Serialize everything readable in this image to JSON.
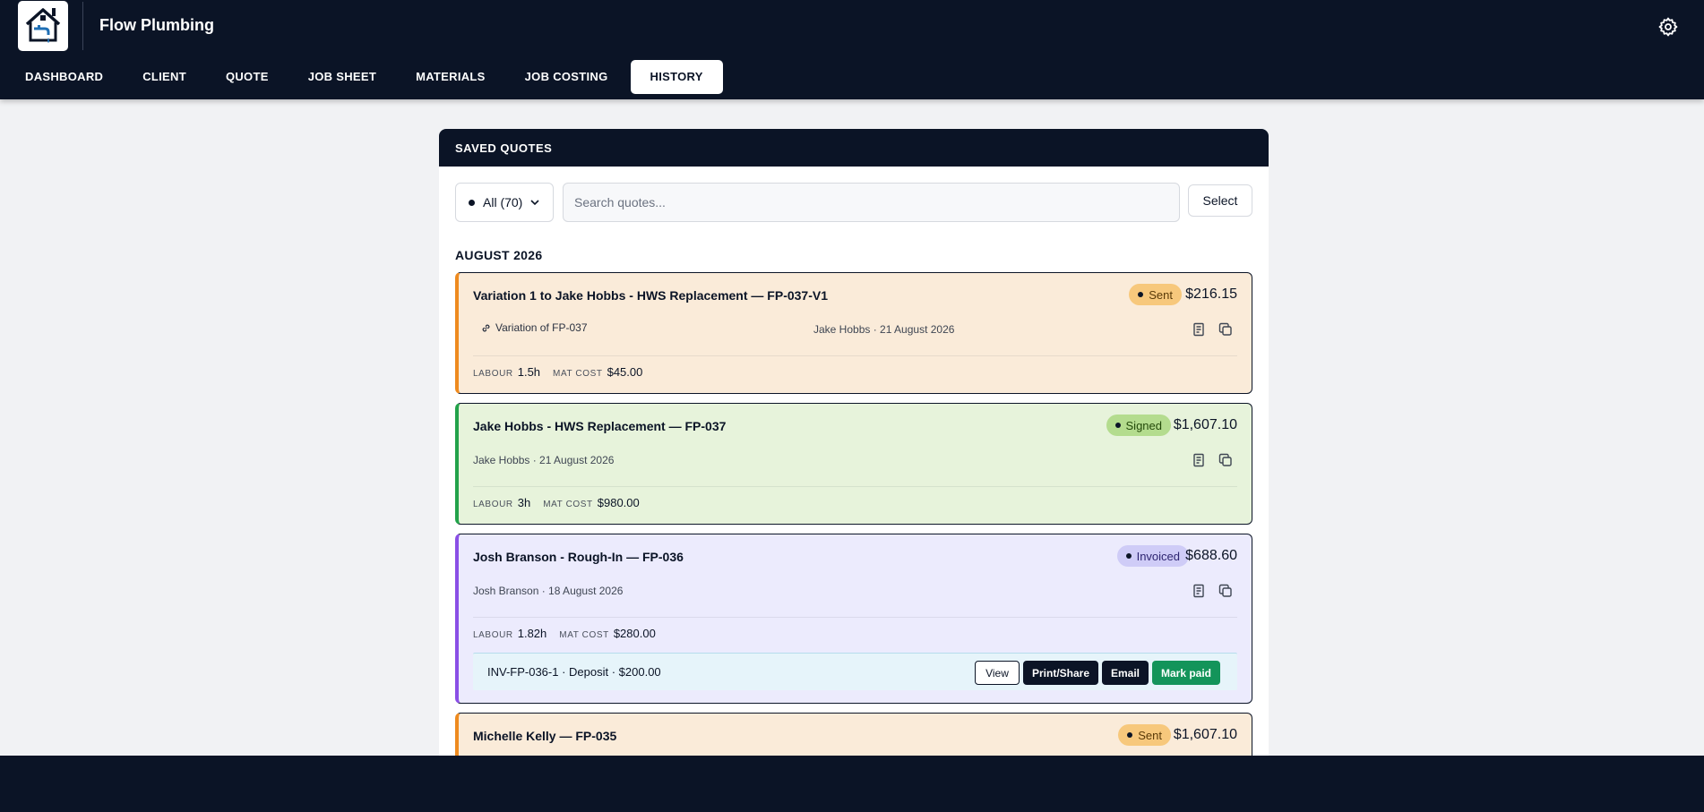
{
  "app": {
    "name": "Flow Plumbing"
  },
  "nav": {
    "items": [
      "DASHBOARD",
      "CLIENT",
      "QUOTE",
      "JOB SHEET",
      "MATERIALS",
      "JOB COSTING",
      "HISTORY"
    ],
    "active": "HISTORY"
  },
  "panel": {
    "title": "SAVED QUOTES",
    "filter_label": "All (70)",
    "search_placeholder": "Search quotes...",
    "select_label": "Select"
  },
  "group": {
    "month": "AUGUST 2026"
  },
  "quotes": [
    {
      "title": "Variation 1 to Jake Hobbs - HWS Replacement — FP-037-V1",
      "status": "Sent",
      "amount": "$216.15",
      "link_text": "Variation of FP-037",
      "meta": "Jake Hobbs · 21 August 2026",
      "labour_label": "LABOUR",
      "labour": "1.5h",
      "mat_label": "MAT COST",
      "mat_cost": "$45.00"
    },
    {
      "title": "Jake Hobbs - HWS Replacement — FP-037",
      "status": "Signed",
      "amount": "$1,607.10",
      "meta": "Jake Hobbs · 21 August 2026",
      "labour_label": "LABOUR",
      "labour": "3h",
      "mat_label": "MAT COST",
      "mat_cost": "$980.00"
    },
    {
      "title": "Josh Branson - Rough-In — FP-036",
      "status": "Invoiced",
      "amount": "$688.60",
      "meta": "Josh Branson · 18 August 2026",
      "labour_label": "LABOUR",
      "labour": "1.82h",
      "mat_label": "MAT COST",
      "mat_cost": "$280.00",
      "invoice": {
        "text": "INV-FP-036-1 · Deposit · $200.00",
        "view": "View",
        "print": "Print/Share",
        "email": "Email",
        "mark_paid": "Mark paid"
      }
    },
    {
      "title": "Michelle Kelly — FP-035",
      "status": "Sent",
      "amount": "$1,607.10"
    }
  ],
  "colors": {
    "navy": "#0b1426",
    "sent": "#f7c87c",
    "signed": "#b4dc8e",
    "invoiced": "#cfccf7",
    "mark_paid": "#13945a"
  },
  "icons": [
    "house-tap-logo-icon",
    "gear-icon",
    "chevron-down-icon",
    "link-icon",
    "document-icon",
    "copy-icon"
  ]
}
